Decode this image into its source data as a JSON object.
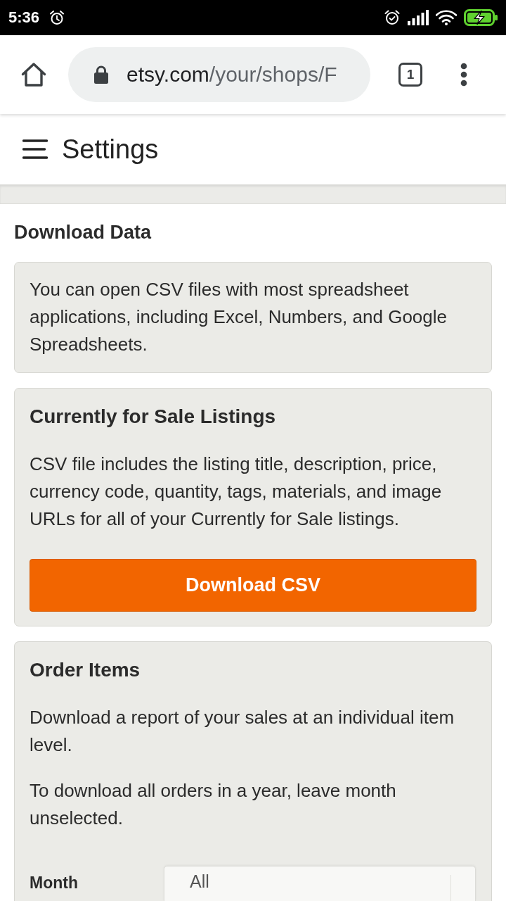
{
  "status_bar": {
    "time": "5:36"
  },
  "browser": {
    "url_host": "etsy.com",
    "url_path": "/your/shops/F",
    "tab_count": "1"
  },
  "header": {
    "title": "Settings"
  },
  "page": {
    "heading": "Download Data"
  },
  "sections": [
    {
      "kind": "note",
      "paragraphs": [
        "You can open CSV files with most spreadsheet applications, including Excel, Numbers, and Google Spreadsheets."
      ]
    },
    {
      "kind": "download",
      "title": "Currently for Sale Listings",
      "paragraphs": [
        "CSV file includes the listing title, description, price, currency code, quantity, tags, materials, and image URLs for all of your Currently for Sale listings."
      ],
      "button": "Download CSV"
    },
    {
      "kind": "form",
      "title": "Order Items",
      "paragraphs": [
        "Download a report of your sales at an individual item level.",
        "To download all orders in a year, leave month unselected."
      ],
      "fields": [
        {
          "label": "Month",
          "value": "All"
        }
      ]
    }
  ]
}
